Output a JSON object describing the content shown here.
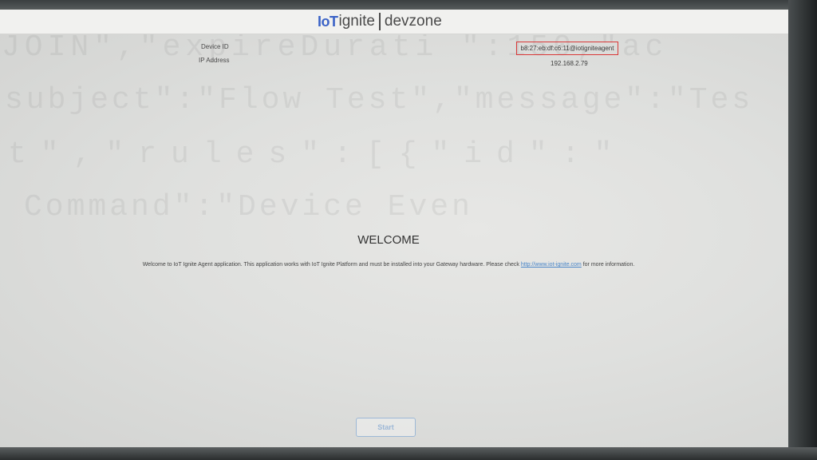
{
  "app": {
    "logo_mark": "IoT",
    "logo_word": "ignite",
    "logo_suffix": "devzone"
  },
  "watermark": {
    "line1": "JOIN\",\"expireDurati  \":150,\"ac",
    "line2": "subject\":\"Flow Test\",\"message\":\"Tes",
    "line3": "t\",\"rules\":[{\"id\":\"",
    "line4": "  Command\":\"Device Even"
  },
  "device_info": {
    "device_id_label": "Device ID",
    "ip_address_label": "IP Address",
    "device_id_value": "b8:27:eb:df:c6:11@iotigniteagent",
    "ip_address_value": "192.168.2.79"
  },
  "welcome": {
    "title": "WELCOME",
    "text_before_link": "Welcome to IoT Ignite Agent application. This application works with IoT Ignite Platform and must be installed into your Gateway hardware. Please check ",
    "link_text": "http://www.iot-ignite.com",
    "text_after_link": " for more information."
  },
  "actions": {
    "start_label": "Start"
  },
  "colors": {
    "brand_blue": "#3b63c7",
    "highlight_red": "#d93838",
    "button_border": "#9db8d6",
    "link": "#4a86c8"
  }
}
